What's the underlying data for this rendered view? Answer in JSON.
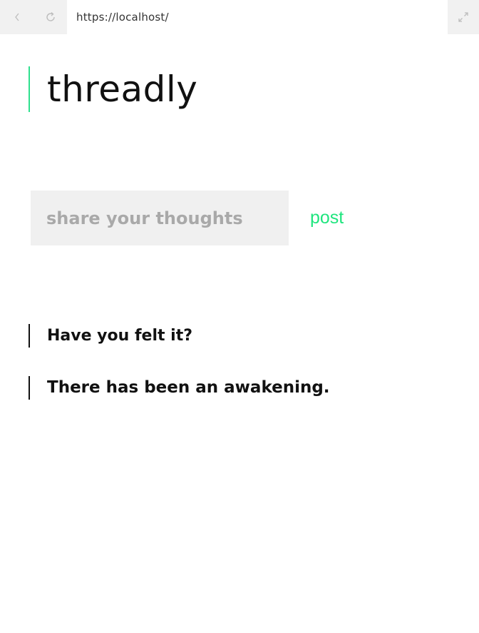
{
  "browser": {
    "url": "https://localhost/",
    "back_icon": "chevron-left-icon",
    "reload_icon": "reload-icon",
    "expand_icon": "expand-icon"
  },
  "app": {
    "title": "threadly",
    "accent_color": "#2ee08e"
  },
  "composer": {
    "placeholder": "share your thoughts",
    "value": "",
    "post_label": "post"
  },
  "threads": [
    {
      "text": "Have you felt it?"
    },
    {
      "text": "There has been an awakening."
    }
  ]
}
